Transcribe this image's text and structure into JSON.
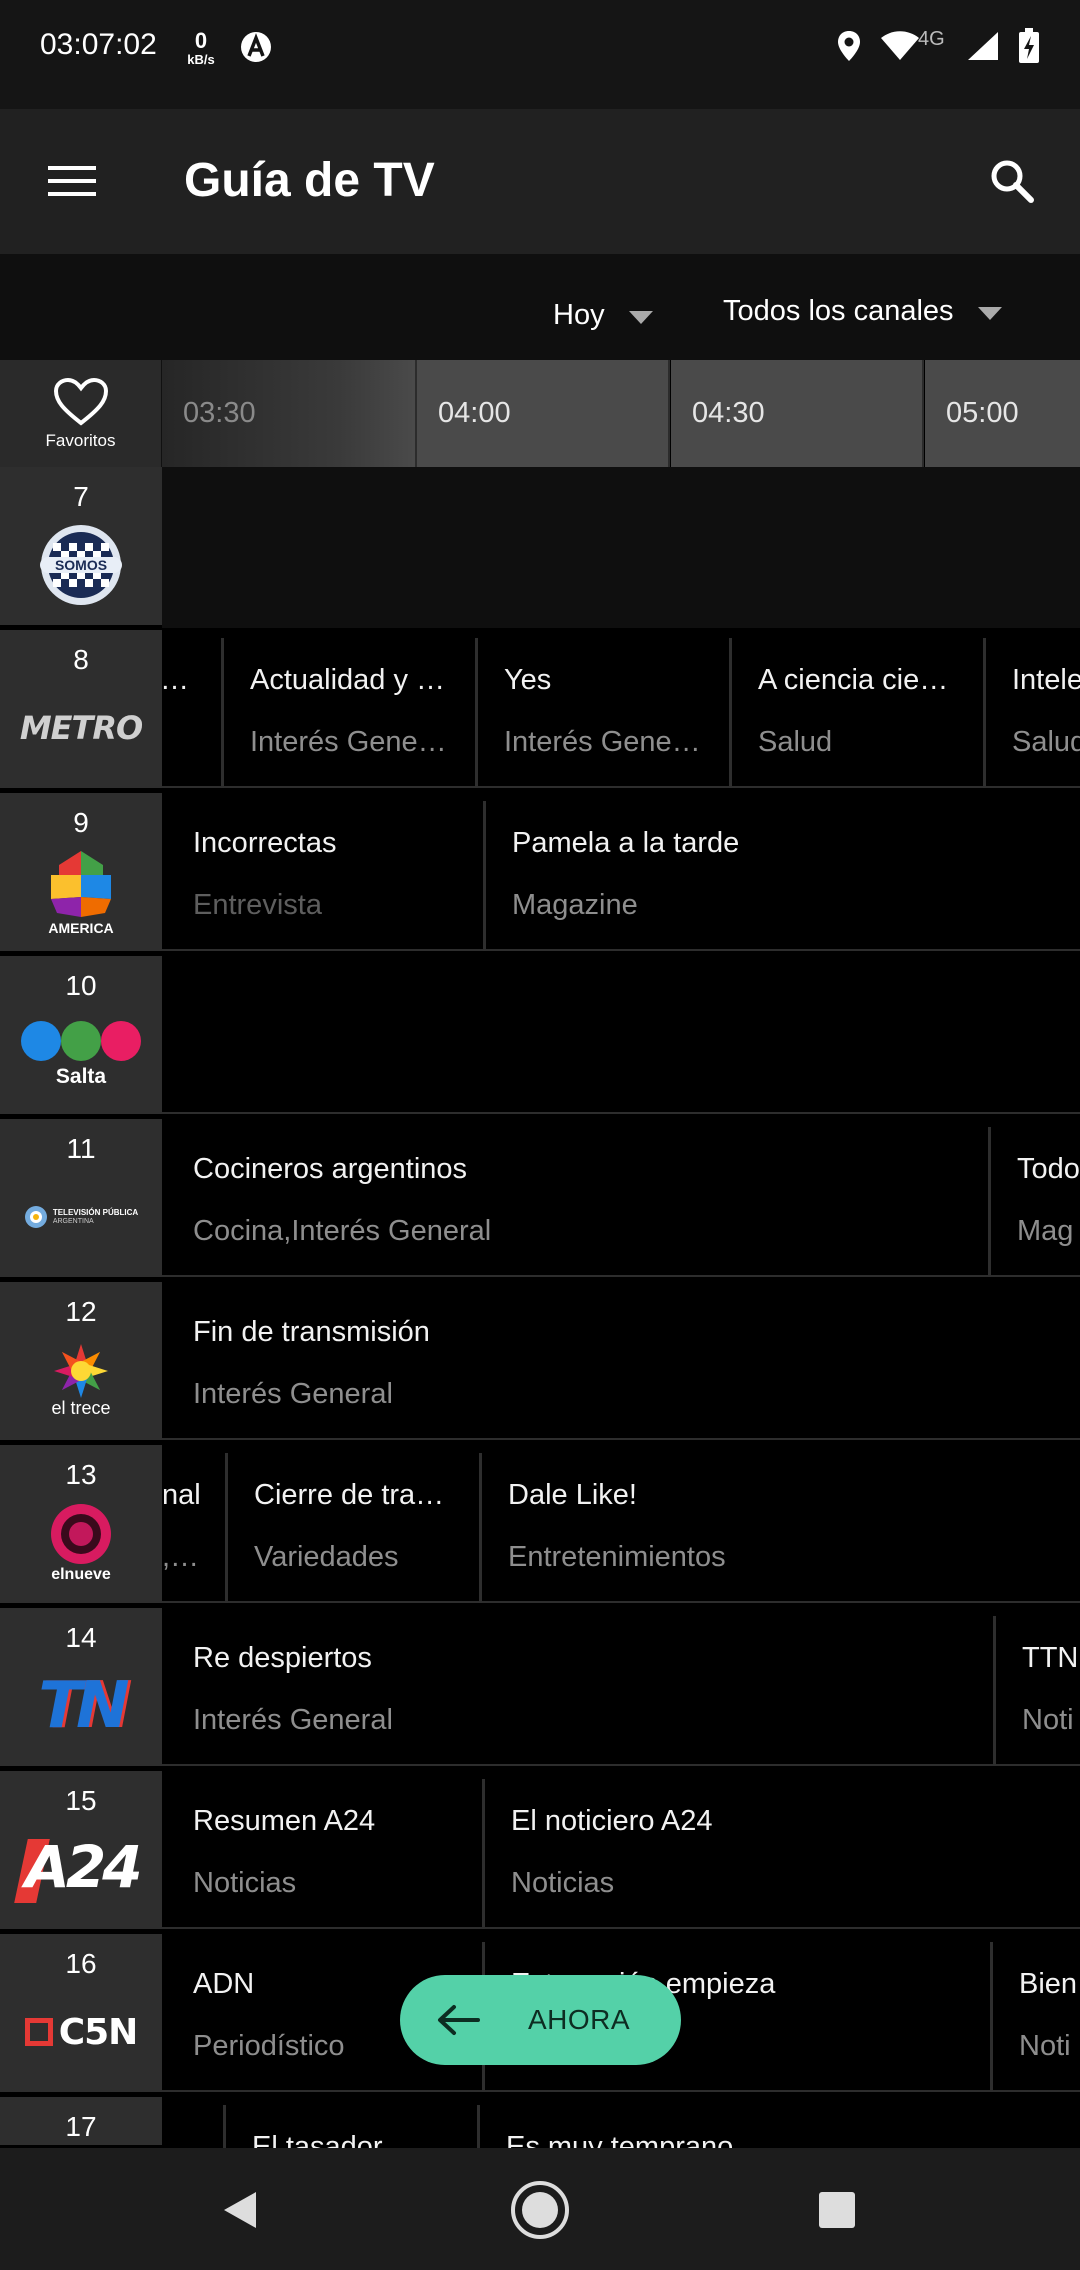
{
  "status_bar": {
    "time": "03:07:02",
    "speed_value": "0",
    "speed_unit": "kB/s",
    "network": "4G"
  },
  "app_bar": {
    "title": "Guía de TV"
  },
  "filters": {
    "day": "Hoy",
    "channels": "Todos los canales"
  },
  "time_header": {
    "favorites_label": "Favoritos",
    "slots": [
      "03:30",
      "04:00",
      "04:30",
      "05:00"
    ]
  },
  "channels": [
    {
      "number": "7",
      "logo": "somos-logo",
      "programs": []
    },
    {
      "number": "8",
      "logo": "metro-logo",
      "programs": [
        {
          "title": "…",
          "genre": ""
        },
        {
          "title": "Actualidad y …",
          "genre": "Interés Gene…"
        },
        {
          "title": "Yes",
          "genre": "Interés Gene…"
        },
        {
          "title": "A ciencia cie…",
          "genre": "Salud"
        },
        {
          "title": "Intele",
          "genre": "Salud"
        }
      ]
    },
    {
      "number": "9",
      "logo": "america-logo",
      "programs": [
        {
          "title": "Incorrectas",
          "genre": "Entrevista"
        },
        {
          "title": "Pamela a la tarde",
          "genre": "Magazine"
        }
      ]
    },
    {
      "number": "10",
      "logo": "canal10-salta-logo",
      "logo_text": "Salta",
      "programs": []
    },
    {
      "number": "11",
      "logo": "television-publica-logo",
      "logo_text": "TELEVISIÓN PÚBLICA",
      "logo_subtext": "ARGENTINA",
      "programs": [
        {
          "title": "Cocineros argentinos",
          "genre": "Cocina,Interés General"
        },
        {
          "title": "Todo",
          "genre": "Mag"
        }
      ]
    },
    {
      "number": "12",
      "logo": "el-trece-logo",
      "logo_text": "el trece",
      "programs": [
        {
          "title": "Fin de transmisión",
          "genre": "Interés General"
        }
      ]
    },
    {
      "number": "13",
      "logo": "el-nueve-logo",
      "logo_text": "elnueve",
      "programs": [
        {
          "title": "nal",
          "genre": ",…"
        },
        {
          "title": "Cierre de tra…",
          "genre": "Variedades"
        },
        {
          "title": "Dale Like!",
          "genre": "Entretenimientos"
        }
      ]
    },
    {
      "number": "14",
      "logo": "tn-logo",
      "logo_text": "TN",
      "programs": [
        {
          "title": "Re despiertos",
          "genre": "Interés General"
        },
        {
          "title": "TTN",
          "genre": "Noti"
        }
      ]
    },
    {
      "number": "15",
      "logo": "a24-logo",
      "logo_text": "A24",
      "programs": [
        {
          "title": "Resumen A24",
          "genre": "Noticias"
        },
        {
          "title": "El noticiero A24",
          "genre": "Noticias"
        }
      ]
    },
    {
      "number": "16",
      "logo": "c5n-logo",
      "logo_text": "C5N",
      "programs": [
        {
          "title": "ADN",
          "genre": "Periodístico"
        },
        {
          "title": "Esta región empieza",
          "genre": ""
        },
        {
          "title": "Bien",
          "genre": "Noti"
        }
      ]
    },
    {
      "number": "17",
      "logo": "",
      "programs": [
        {
          "title": "",
          "genre": ""
        },
        {
          "title": "El tasador",
          "genre": ""
        },
        {
          "title": "Es muy temprano",
          "genre": ""
        }
      ]
    }
  ],
  "fab": {
    "label": "AHORA"
  },
  "logo_texts": {
    "somos": "SOMOS",
    "metro": "METRO",
    "america": "AMERICA"
  },
  "colors": {
    "accent": "#54d1a8",
    "app_bar": "#212121",
    "background": "#000000"
  }
}
